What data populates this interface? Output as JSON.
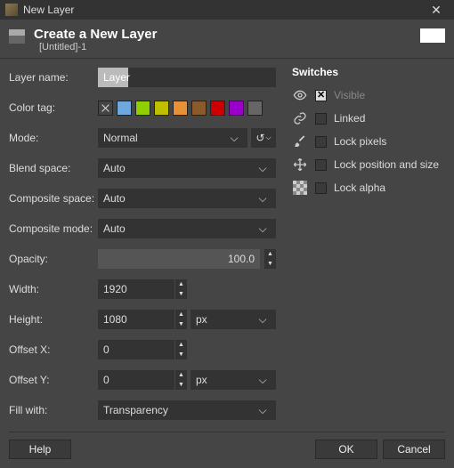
{
  "window": {
    "title": "New Layer"
  },
  "header": {
    "title": "Create a New Layer",
    "subtitle": "[Untitled]-1"
  },
  "form": {
    "layer_name_label": "Layer name:",
    "layer_name_value": "Layer",
    "color_tag_label": "Color tag:",
    "color_tags": [
      "none",
      "#6fa8dc",
      "#8fce00",
      "#bfbf00",
      "#e69138",
      "#8b5a2b",
      "#cc0000",
      "#9900cc",
      "#666666"
    ],
    "mode_label": "Mode:",
    "mode_value": "Normal",
    "blend_space_label": "Blend space:",
    "blend_space_value": "Auto",
    "composite_space_label": "Composite space:",
    "composite_space_value": "Auto",
    "composite_mode_label": "Composite mode:",
    "composite_mode_value": "Auto",
    "opacity_label": "Opacity:",
    "opacity_value": "100.0",
    "width_label": "Width:",
    "width_value": "1920",
    "height_label": "Height:",
    "height_value": "1080",
    "size_unit": "px",
    "offset_x_label": "Offset X:",
    "offset_x_value": "0",
    "offset_y_label": "Offset Y:",
    "offset_y_value": "0",
    "offset_unit": "px",
    "fill_with_label": "Fill with:",
    "fill_with_value": "Transparency"
  },
  "switches": {
    "heading": "Switches",
    "visible": {
      "label": "Visible",
      "checked": true
    },
    "linked": {
      "label": "Linked",
      "checked": false
    },
    "lock_pixels": {
      "label": "Lock pixels",
      "checked": false
    },
    "lock_position": {
      "label": "Lock position and size",
      "checked": false
    },
    "lock_alpha": {
      "label": "Lock alpha",
      "checked": false
    }
  },
  "buttons": {
    "help": "Help",
    "ok": "OK",
    "cancel": "Cancel"
  }
}
